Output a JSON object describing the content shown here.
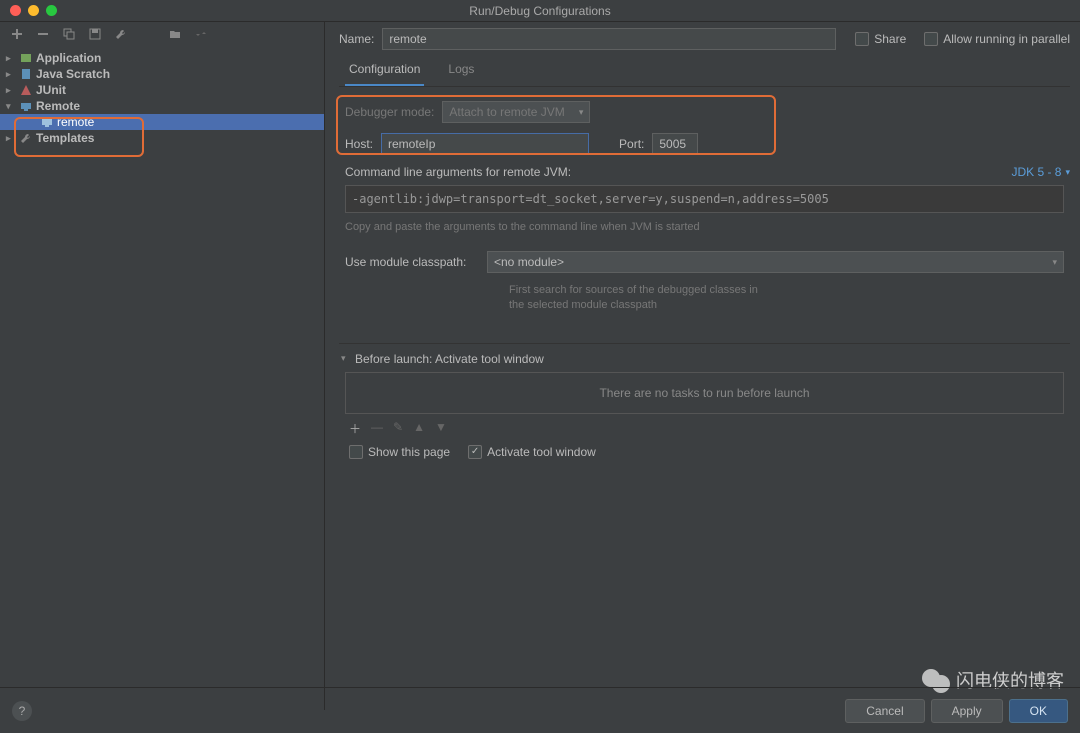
{
  "window": {
    "title": "Run/Debug Configurations"
  },
  "sidebar": {
    "items": [
      {
        "label": "Application"
      },
      {
        "label": "Java Scratch"
      },
      {
        "label": "JUnit"
      },
      {
        "label": "Remote"
      },
      {
        "label": "Templates"
      }
    ],
    "remote_child": "remote"
  },
  "header": {
    "name_label": "Name:",
    "name_value": "remote",
    "share": "Share",
    "allow": "Allow running in parallel"
  },
  "tabs": {
    "configuration": "Configuration",
    "logs": "Logs"
  },
  "config": {
    "debugger_mode_label": "Debugger mode:",
    "debugger_mode_value": "Attach to remote JVM",
    "host_label": "Host:",
    "host_value": "remoteIp",
    "port_label": "Port:",
    "port_value": "5005",
    "cmd_label": "Command line arguments for remote JVM:",
    "jdk_label": "JDK 5 - 8",
    "cmd_value": "-agentlib:jdwp=transport=dt_socket,server=y,suspend=n,address=5005",
    "cmd_hint": "Copy and paste the arguments to the command line when JVM is started",
    "module_label": "Use module classpath:",
    "module_value": "<no module>",
    "module_hint": "First search for sources of the debugged classes in the selected module classpath"
  },
  "before": {
    "title": "Before launch: Activate tool window",
    "empty": "There are no tasks to run before launch",
    "show_this_page": "Show this page",
    "activate_tool_window": "Activate tool window"
  },
  "footer": {
    "cancel": "Cancel",
    "apply": "Apply",
    "ok": "OK"
  },
  "watermark": {
    "text": "闪电侠的博客"
  }
}
